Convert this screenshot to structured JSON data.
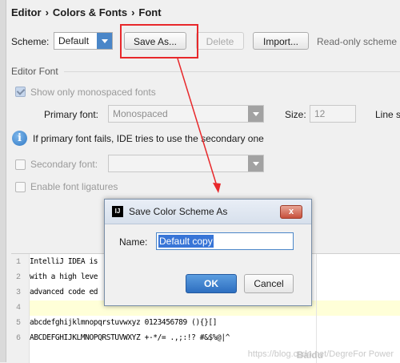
{
  "breadcrumb": {
    "part1": "Editor",
    "part2": "Colors & Fonts",
    "part3": "Font"
  },
  "scheme": {
    "label": "Scheme:",
    "selected": "Default",
    "save_as": "Save As...",
    "delete": "Delete",
    "import": "Import...",
    "read_only_note": "Read-only scheme"
  },
  "editor_font": {
    "section_label": "Editor Font",
    "show_mono_label": "Show only monospaced fonts",
    "primary_font_label": "Primary font:",
    "primary_font_value": "Monospaced",
    "size_label": "Size:",
    "size_value": "12",
    "line_spacing_label": "Line s",
    "fallback_info": "If primary font fails, IDE tries to use the secondary one",
    "secondary_font_label": "Secondary font:",
    "secondary_font_value": "",
    "ligatures_label": "Enable font ligatures"
  },
  "preview": {
    "lines": [
      {
        "num": "1",
        "text": "IntelliJ IDEA is"
      },
      {
        "num": "2",
        "text": "with a high leve"
      },
      {
        "num": "3",
        "text": "advanced code ed"
      },
      {
        "num": "4",
        "text": ""
      },
      {
        "num": "5",
        "text": "abcdefghijklmnopqrstuvwxyz 0123456789 (){}[]"
      },
      {
        "num": "6",
        "text": "ABCDEFGHIJKLMNOPQRSTUVWXYZ +-*/= .,;:!? #&$%@|^"
      }
    ]
  },
  "dialog": {
    "title": "Save Color Scheme As",
    "logo_text": "IJ",
    "close_glyph": "x",
    "name_label": "Name:",
    "name_value": "Default copy",
    "ok": "OK",
    "cancel": "Cancel"
  },
  "watermark": {
    "text": "https://blog.csdn.net/DegreFor Power",
    "icon_text": "Baidu"
  },
  "colors": {
    "accent": "#4a86c8",
    "annotation": "#e8282b",
    "selection": "#3875d7"
  }
}
